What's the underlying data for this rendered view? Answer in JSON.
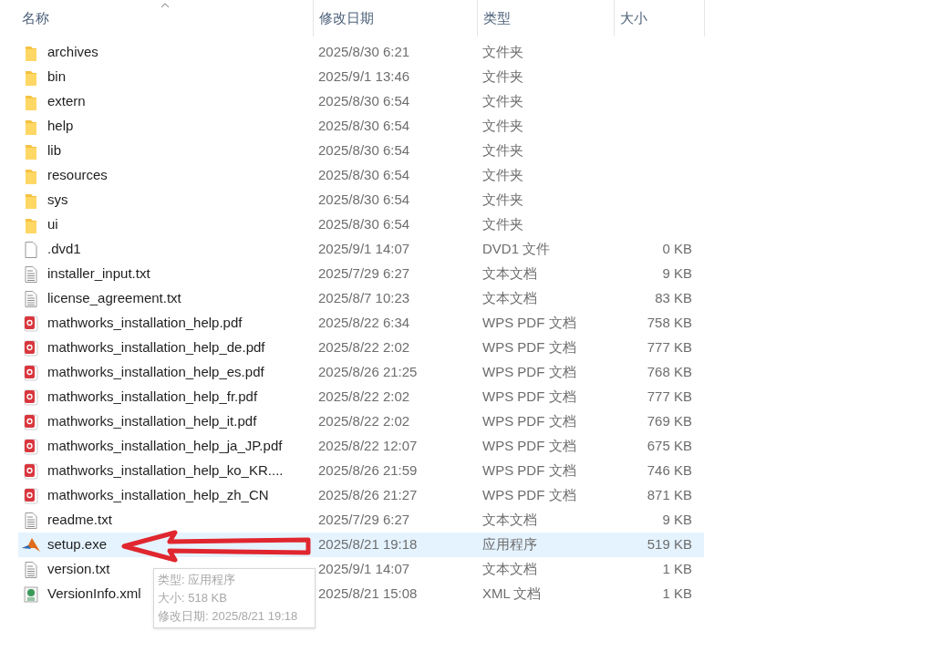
{
  "columns": [
    {
      "label": "名称",
      "sorted": true
    },
    {
      "label": "修改日期",
      "sorted": false
    },
    {
      "label": "类型",
      "sorted": false
    },
    {
      "label": "大小",
      "sorted": false
    }
  ],
  "rows": [
    {
      "kind": "folder",
      "name": "archives",
      "date": "2025/8/30 6:21",
      "type": "文件夹",
      "selected": false
    },
    {
      "kind": "folder",
      "name": "bin",
      "date": "2025/9/1 13:46",
      "type": "文件夹",
      "selected": false
    },
    {
      "kind": "folder",
      "name": "extern",
      "date": "2025/8/30 6:54",
      "type": "文件夹",
      "selected": false
    },
    {
      "kind": "folder",
      "name": "help",
      "date": "2025/8/30 6:54",
      "type": "文件夹",
      "selected": false
    },
    {
      "kind": "folder",
      "name": "lib",
      "date": "2025/8/30 6:54",
      "type": "文件夹",
      "selected": false
    },
    {
      "kind": "folder",
      "name": "resources",
      "date": "2025/8/30 6:54",
      "type": "文件夹",
      "selected": false
    },
    {
      "kind": "folder",
      "name": "sys",
      "date": "2025/8/30 6:54",
      "type": "文件夹",
      "selected": false
    },
    {
      "kind": "folder",
      "name": "ui",
      "date": "2025/8/30 6:54",
      "type": "文件夹",
      "selected": false
    },
    {
      "kind": "file",
      "name": ".dvd1",
      "date": "2025/9/1 14:07",
      "type": "DVD1 文件",
      "size": "0 KB",
      "selected": false
    },
    {
      "kind": "text",
      "name": "installer_input.txt",
      "date": "2025/7/29 6:27",
      "type": "文本文档",
      "size": "9 KB",
      "selected": false
    },
    {
      "kind": "text",
      "name": "license_agreement.txt",
      "date": "2025/8/7 10:23",
      "type": "文本文档",
      "size": "83 KB",
      "selected": false
    },
    {
      "kind": "pdf",
      "name": "mathworks_installation_help.pdf",
      "date": "2025/8/22 6:34",
      "type": "WPS PDF 文档",
      "size": "758 KB",
      "selected": false
    },
    {
      "kind": "pdf",
      "name": "mathworks_installation_help_de.pdf",
      "date": "2025/8/22 2:02",
      "type": "WPS PDF 文档",
      "size": "777 KB",
      "selected": false
    },
    {
      "kind": "pdf",
      "name": "mathworks_installation_help_es.pdf",
      "date": "2025/8/26 21:25",
      "type": "WPS PDF 文档",
      "size": "768 KB",
      "selected": false
    },
    {
      "kind": "pdf",
      "name": "mathworks_installation_help_fr.pdf",
      "date": "2025/8/22 2:02",
      "type": "WPS PDF 文档",
      "size": "777 KB",
      "selected": false
    },
    {
      "kind": "pdf",
      "name": "mathworks_installation_help_it.pdf",
      "date": "2025/8/22 2:02",
      "type": "WPS PDF 文档",
      "size": "769 KB",
      "selected": false
    },
    {
      "kind": "pdf",
      "name": "mathworks_installation_help_ja_JP.pdf",
      "date": "2025/8/22 12:07",
      "type": "WPS PDF 文档",
      "size": "675 KB",
      "selected": false
    },
    {
      "kind": "pdf",
      "name": "mathworks_installation_help_ko_KR....",
      "date": "2025/8/26 21:59",
      "type": "WPS PDF 文档",
      "size": "746 KB",
      "selected": false
    },
    {
      "kind": "pdf",
      "name": "mathworks_installation_help_zh_CN",
      "date": "2025/8/26 21:27",
      "type": "WPS PDF 文档",
      "size": "871 KB",
      "selected": false
    },
    {
      "kind": "text",
      "name": "readme.txt",
      "date": "2025/7/29 6:27",
      "type": "文本文档",
      "size": "9 KB",
      "selected": false
    },
    {
      "kind": "app",
      "name": "setup.exe",
      "date": "2025/8/21 19:18",
      "type": "应用程序",
      "size": "519 KB",
      "selected": true
    },
    {
      "kind": "text",
      "name": "version.txt",
      "date": "2025/9/1 14:07",
      "type": "文本文档",
      "size": "1 KB",
      "selected": false
    },
    {
      "kind": "xml",
      "name": "VersionInfo.xml",
      "date": "2025/8/21 15:08",
      "type": "XML 文档",
      "size": "1 KB",
      "selected": false
    }
  ],
  "tooltip": [
    "类型: 应用程序",
    "大小: 518 KB",
    "修改日期: 2025/8/21 19:18"
  ]
}
